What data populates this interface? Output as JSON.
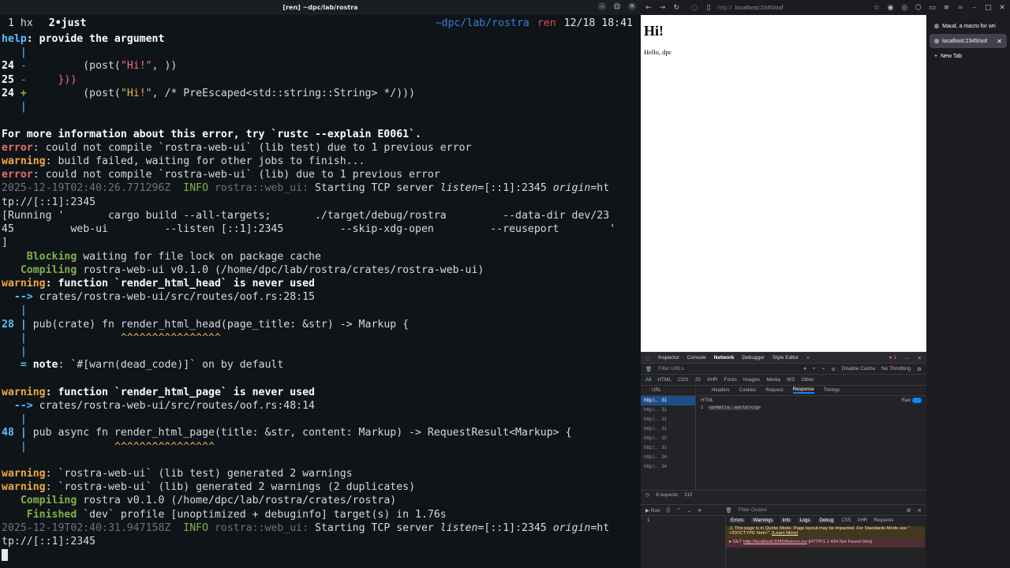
{
  "window": {
    "title": "[ren] ~dpc/lab/rostra"
  },
  "tmux": {
    "windows": [
      {
        "label": "1 hx"
      },
      {
        "label": "2•just"
      }
    ],
    "path": "~dpc/lab/rostra",
    "session": "ren",
    "datetime": "12/18 18:41"
  },
  "terminal": {
    "l01": {
      "a": "help",
      "b": ": provide the argument"
    },
    "l02": {
      "a": "   |"
    },
    "l03": {
      "a": "24 ",
      "b": "-",
      "c": "         (post(",
      "d": "\"Hi!\"",
      "e": ", ))"
    },
    "l04": {
      "a": "25 ",
      "b": "-",
      "c": "     }))"
    },
    "l05": {
      "a": "24 ",
      "b": "+",
      "c": "         (post(",
      "d": "\"Hi!\"",
      "e": ", /* PreEscaped<std::string::String> */)))"
    },
    "l06": {
      "a": "   |"
    },
    "l07": {
      "a": ""
    },
    "l08": {
      "a": "For more information about this error, try `rustc --explain E0061`."
    },
    "l09": {
      "a": "error",
      "b": ": could not compile `rostra-web-ui` (lib test) due to 1 previous error"
    },
    "l10": {
      "a": "warning",
      "b": ": build failed, waiting for other jobs to finish..."
    },
    "l11": {
      "a": "error",
      "b": ": could not compile `rostra-web-ui` (lib) due to 1 previous error"
    },
    "l12": {
      "a": "2025-12-19T02:40:26.771296Z ",
      "b": " INFO",
      "c": " rostra::web_ui:",
      "d": " Starting TCP server ",
      "e": "listen",
      "f": "=[::1]:2345 ",
      "g": "origin",
      "h": "=ht"
    },
    "l13": {
      "a": "tp://[::1]:2345"
    },
    "l14": {
      "a": "[Running '       cargo build --all-targets;       ./target/debug/rostra         --data-dir dev/23"
    },
    "l15": {
      "a": "45         web-ui         --listen [::1]:2345         --skip-xdg-open         --reuseport        '"
    },
    "l16": {
      "a": "]"
    },
    "l17": {
      "a": "    Blocking",
      "b": " waiting for file lock on package cache"
    },
    "l18": {
      "a": "   Compiling",
      "b": " rostra-web-ui v0.1.0 (/home/dpc/lab/rostra/crates/rostra-web-ui)"
    },
    "l19": {
      "a": "warning",
      "b": ": function `render_html_head` is never used"
    },
    "l20": {
      "a": "  -->",
      "b": " crates/rostra-web-ui/src/routes/oof.rs:28:15"
    },
    "l21": {
      "a": "   |"
    },
    "l22": {
      "a": "28 |",
      "b": " pub(crate) fn render_html_head(page_title: &str) -> Markup {"
    },
    "l23": {
      "a": "   |",
      "b": "               ^^^^^^^^^^^^^^^^"
    },
    "l24": {
      "a": "   |"
    },
    "l25": {
      "a": "   =",
      "b": " note",
      "c": ": `#[warn(dead_code)]` on by default"
    },
    "l26": {
      "a": ""
    },
    "l27": {
      "a": "warning",
      "b": ": function `render_html_page` is never used"
    },
    "l28": {
      "a": "  -->",
      "b": " crates/rostra-web-ui/src/routes/oof.rs:48:14"
    },
    "l29": {
      "a": "   |"
    },
    "l30": {
      "a": "48 |",
      "b": " pub async fn render_html_page(title: &str, content: Markup) -> RequestResult<Markup> {"
    },
    "l31": {
      "a": "   |",
      "b": "              ^^^^^^^^^^^^^^^^"
    },
    "l32": {
      "a": ""
    },
    "l33": {
      "a": "warning",
      "b": ": `rostra-web-ui` (lib test) generated 2 warnings"
    },
    "l34": {
      "a": "warning",
      "b": ": `rostra-web-ui` (lib) generated 2 warnings (2 duplicates)"
    },
    "l35": {
      "a": "   Compiling",
      "b": " rostra v0.1.0 (/home/dpc/lab/rostra/crates/rostra)"
    },
    "l36": {
      "a": "    Finished",
      "b": " `dev` profile [unoptimized + debuginfo] target(s) in 1.76s"
    },
    "l37": {
      "a": "2025-12-19T02:40:31.947158Z ",
      "b": " INFO",
      "c": " rostra::web_ui:",
      "d": " Starting TCP server ",
      "e": "listen",
      "f": "=[::1]:2345 ",
      "g": "origin",
      "h": "=ht"
    },
    "l38": {
      "a": "tp://[::1]:2345"
    }
  },
  "browser": {
    "url_prefix": "http://",
    "url_host": "localhost:2345/oof",
    "page_heading": "Hi!",
    "page_text": "Hello, dpc",
    "tabs": [
      {
        "label": "Maud, a macro for wri"
      },
      {
        "label": "localhost:2345/oof"
      }
    ],
    "new_tab_label": "New Tab"
  },
  "devtools": {
    "tabs": [
      "Inspector",
      "Console",
      "Network",
      "Debugger",
      "Style Editor"
    ],
    "error_count": "1",
    "filter_placeholder": "Filter URLs",
    "types": [
      "All",
      "HTML",
      "CSS",
      "JS",
      "XHR",
      "Fonts",
      "Images",
      "Media",
      "WS",
      "Other"
    ],
    "disable_cache": "Disable Cache",
    "throttling": "No Throttling",
    "url_header": "URL",
    "requests": [
      {
        "url": "http:/...",
        "size": "31"
      },
      {
        "url": "http:/...",
        "size": "31"
      },
      {
        "url": "http:/...",
        "size": "31"
      },
      {
        "url": "http:/...",
        "size": "31"
      },
      {
        "url": "http:/...",
        "size": "30"
      },
      {
        "url": "http:/...",
        "size": "31"
      },
      {
        "url": "http:/...",
        "size": "34"
      },
      {
        "url": "http:/...",
        "size": "34"
      }
    ],
    "detail_tabs": [
      "Headers",
      "Cookies",
      "Request",
      "Response",
      "Timings"
    ],
    "response_type": "HTML",
    "raw_label": "Raw",
    "response_line_no": "1",
    "response_body": "<p>Hello, world!</p>",
    "request_count": "8 requests",
    "transferred": "210",
    "console_filter": "Filter Output",
    "console_levels": [
      "Errors",
      "Warnings",
      "Info",
      "Logs",
      "Debug",
      "CSS",
      "XHR",
      "Requests"
    ],
    "console_gutter": "1",
    "warn_msg": "This page is in Quirks Mode. Page layout may be impacted. For Standards Mode use \"<!DOCTYPE html>\".",
    "warn_link": "[Learn More]",
    "err_method": "GET",
    "err_url": "http://localhost:2345/favicon.ico",
    "err_status": "[HTTP/1.1 404 Not Found 0ms]"
  }
}
